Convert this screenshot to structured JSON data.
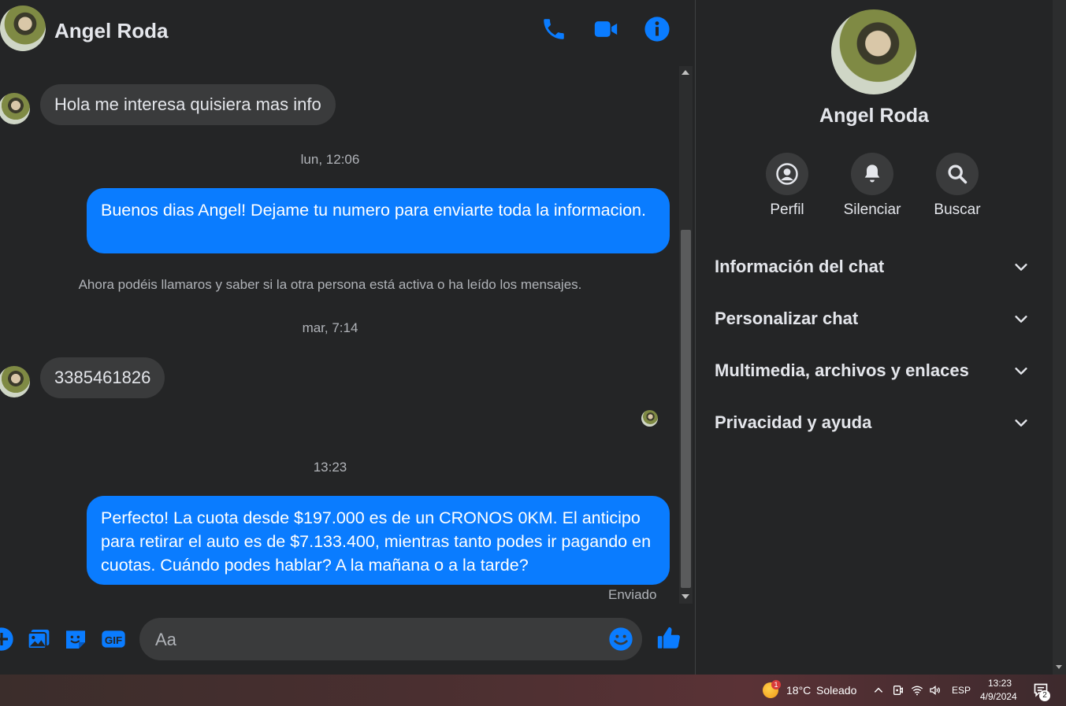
{
  "header": {
    "contact_name": "Angel Roda"
  },
  "messages": {
    "incoming_1": "Hola me interesa quisiera mas info",
    "timestamp_1": "lun, 12:06",
    "outgoing_1": "Buenos dias Angel! Dejame tu numero para enviarte toda la informacion.",
    "system_notice": "Ahora podéis llamaros y saber si la otra persona está activa o ha leído los mensajes.",
    "timestamp_2": "mar, 7:14",
    "incoming_2": "3385461826",
    "timestamp_3": "13:23",
    "outgoing_2": "Perfecto! La cuota desde $197.000 es de un CRONOS 0KM. El anticipo para retirar el auto es de $7.133.400, mientras tanto podes ir pagando en cuotas. Cuándo podes hablar? A la mañana o a la tarde?",
    "status": "Enviado"
  },
  "composer": {
    "placeholder": "Aa"
  },
  "side_panel": {
    "name": "Angel Roda",
    "actions": [
      {
        "label": "Perfil",
        "icon": "profile-icon"
      },
      {
        "label": "Silenciar",
        "icon": "bell-icon"
      },
      {
        "label": "Buscar",
        "icon": "search-icon"
      }
    ],
    "sections": [
      "Información del chat",
      "Personalizar chat",
      "Multimedia, archivos y enlaces",
      "Privacidad y ayuda"
    ]
  },
  "taskbar": {
    "weather_temp": "18°C",
    "weather_text": "Soleado",
    "weather_badge": "1",
    "language": "ESP",
    "time": "13:23",
    "date": "4/9/2024",
    "notification_count": "2"
  },
  "colors": {
    "accent": "#0a7cff",
    "background": "#242526",
    "bubble_in": "#3a3b3c"
  }
}
